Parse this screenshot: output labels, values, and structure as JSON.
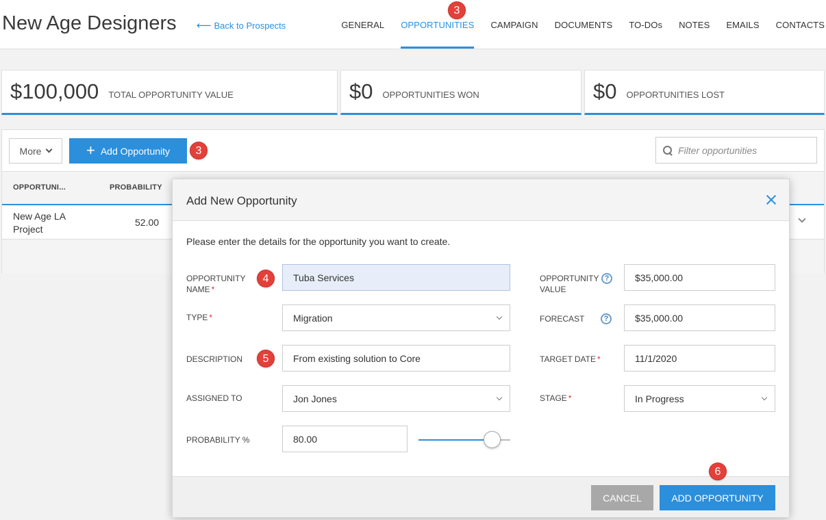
{
  "header": {
    "title": "New Age Designers",
    "back_link": "Back to Prospects",
    "tabs": [
      {
        "label": "GENERAL"
      },
      {
        "label": "OPPORTUNITIES",
        "active": true
      },
      {
        "label": "CAMPAIGN"
      },
      {
        "label": "DOCUMENTS"
      },
      {
        "label": "TO-DOs"
      },
      {
        "label": "NOTES"
      },
      {
        "label": "EMAILS"
      },
      {
        "label": "CONTACTS"
      }
    ]
  },
  "markers": {
    "tab": "3",
    "add": "3",
    "name": "4",
    "description": "5",
    "submit": "6"
  },
  "stats": [
    {
      "value": "$100,000",
      "label": "TOTAL OPPORTUNITY VALUE"
    },
    {
      "value": "$0",
      "label": "OPPORTUNITIES WON"
    },
    {
      "value": "$0",
      "label": "OPPORTUNITIES LOST"
    }
  ],
  "toolbar": {
    "more_label": "More",
    "add_label": "Add Opportunity",
    "filter_placeholder": "Filter opportunities"
  },
  "table": {
    "columns": [
      "OPPORTUNI...",
      "PROBABILITY"
    ],
    "rows": [
      {
        "name": "New Age LA Project",
        "probability": "52.00"
      }
    ]
  },
  "modal": {
    "title": "Add New Opportunity",
    "intro": "Please enter the details for the opportunity you want to create.",
    "labels": {
      "opportunity_name": "OPPORTUNITY NAME",
      "type": "TYPE",
      "description": "DESCRIPTION",
      "assigned_to": "ASSIGNED TO",
      "probability": "PROBABILITY %",
      "opportunity_value": "OPPORTUNITY VALUE",
      "forecast": "FORECAST",
      "target_date": "TARGET DATE",
      "stage": "STAGE"
    },
    "values": {
      "opportunity_name": "Tuba Services",
      "type": "Migration",
      "description": "From existing solution to Core",
      "assigned_to": "Jon Jones",
      "probability": "80.00",
      "opportunity_value": "$35,000.00",
      "forecast": "$35,000.00",
      "target_date": "11/1/2020",
      "stage": "In Progress"
    },
    "probability_slider_fraction": 0.8,
    "help_glyph": "?",
    "required_mark": "*",
    "cancel_label": "CANCEL",
    "submit_label": "ADD OPPORTUNITY"
  },
  "colors": {
    "accent": "#2b8fdc",
    "marker": "#e4403a",
    "required": "#d9302b"
  },
  "icons": [
    "arrow-left-icon",
    "plus-icon",
    "search-icon",
    "chevron-down-icon",
    "close-icon",
    "help-icon"
  ]
}
